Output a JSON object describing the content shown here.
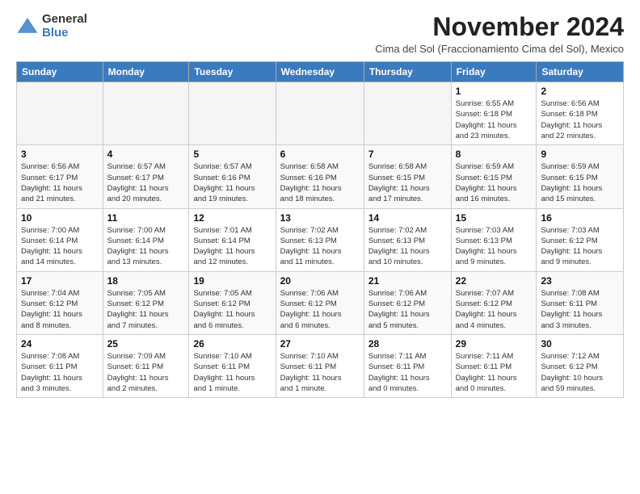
{
  "header": {
    "logo_general": "General",
    "logo_blue": "Blue",
    "month_title": "November 2024",
    "location": "Cima del Sol (Fraccionamiento Cima del Sol), Mexico"
  },
  "weekdays": [
    "Sunday",
    "Monday",
    "Tuesday",
    "Wednesday",
    "Thursday",
    "Friday",
    "Saturday"
  ],
  "weeks": [
    [
      {
        "day": "",
        "info": ""
      },
      {
        "day": "",
        "info": ""
      },
      {
        "day": "",
        "info": ""
      },
      {
        "day": "",
        "info": ""
      },
      {
        "day": "",
        "info": ""
      },
      {
        "day": "1",
        "info": "Sunrise: 6:55 AM\nSunset: 6:18 PM\nDaylight: 11 hours\nand 23 minutes."
      },
      {
        "day": "2",
        "info": "Sunrise: 6:56 AM\nSunset: 6:18 PM\nDaylight: 11 hours\nand 22 minutes."
      }
    ],
    [
      {
        "day": "3",
        "info": "Sunrise: 6:56 AM\nSunset: 6:17 PM\nDaylight: 11 hours\nand 21 minutes."
      },
      {
        "day": "4",
        "info": "Sunrise: 6:57 AM\nSunset: 6:17 PM\nDaylight: 11 hours\nand 20 minutes."
      },
      {
        "day": "5",
        "info": "Sunrise: 6:57 AM\nSunset: 6:16 PM\nDaylight: 11 hours\nand 19 minutes."
      },
      {
        "day": "6",
        "info": "Sunrise: 6:58 AM\nSunset: 6:16 PM\nDaylight: 11 hours\nand 18 minutes."
      },
      {
        "day": "7",
        "info": "Sunrise: 6:58 AM\nSunset: 6:15 PM\nDaylight: 11 hours\nand 17 minutes."
      },
      {
        "day": "8",
        "info": "Sunrise: 6:59 AM\nSunset: 6:15 PM\nDaylight: 11 hours\nand 16 minutes."
      },
      {
        "day": "9",
        "info": "Sunrise: 6:59 AM\nSunset: 6:15 PM\nDaylight: 11 hours\nand 15 minutes."
      }
    ],
    [
      {
        "day": "10",
        "info": "Sunrise: 7:00 AM\nSunset: 6:14 PM\nDaylight: 11 hours\nand 14 minutes."
      },
      {
        "day": "11",
        "info": "Sunrise: 7:00 AM\nSunset: 6:14 PM\nDaylight: 11 hours\nand 13 minutes."
      },
      {
        "day": "12",
        "info": "Sunrise: 7:01 AM\nSunset: 6:14 PM\nDaylight: 11 hours\nand 12 minutes."
      },
      {
        "day": "13",
        "info": "Sunrise: 7:02 AM\nSunset: 6:13 PM\nDaylight: 11 hours\nand 11 minutes."
      },
      {
        "day": "14",
        "info": "Sunrise: 7:02 AM\nSunset: 6:13 PM\nDaylight: 11 hours\nand 10 minutes."
      },
      {
        "day": "15",
        "info": "Sunrise: 7:03 AM\nSunset: 6:13 PM\nDaylight: 11 hours\nand 9 minutes."
      },
      {
        "day": "16",
        "info": "Sunrise: 7:03 AM\nSunset: 6:12 PM\nDaylight: 11 hours\nand 9 minutes."
      }
    ],
    [
      {
        "day": "17",
        "info": "Sunrise: 7:04 AM\nSunset: 6:12 PM\nDaylight: 11 hours\nand 8 minutes."
      },
      {
        "day": "18",
        "info": "Sunrise: 7:05 AM\nSunset: 6:12 PM\nDaylight: 11 hours\nand 7 minutes."
      },
      {
        "day": "19",
        "info": "Sunrise: 7:05 AM\nSunset: 6:12 PM\nDaylight: 11 hours\nand 6 minutes."
      },
      {
        "day": "20",
        "info": "Sunrise: 7:06 AM\nSunset: 6:12 PM\nDaylight: 11 hours\nand 6 minutes."
      },
      {
        "day": "21",
        "info": "Sunrise: 7:06 AM\nSunset: 6:12 PM\nDaylight: 11 hours\nand 5 minutes."
      },
      {
        "day": "22",
        "info": "Sunrise: 7:07 AM\nSunset: 6:12 PM\nDaylight: 11 hours\nand 4 minutes."
      },
      {
        "day": "23",
        "info": "Sunrise: 7:08 AM\nSunset: 6:11 PM\nDaylight: 11 hours\nand 3 minutes."
      }
    ],
    [
      {
        "day": "24",
        "info": "Sunrise: 7:08 AM\nSunset: 6:11 PM\nDaylight: 11 hours\nand 3 minutes."
      },
      {
        "day": "25",
        "info": "Sunrise: 7:09 AM\nSunset: 6:11 PM\nDaylight: 11 hours\nand 2 minutes."
      },
      {
        "day": "26",
        "info": "Sunrise: 7:10 AM\nSunset: 6:11 PM\nDaylight: 11 hours\nand 1 minute."
      },
      {
        "day": "27",
        "info": "Sunrise: 7:10 AM\nSunset: 6:11 PM\nDaylight: 11 hours\nand 1 minute."
      },
      {
        "day": "28",
        "info": "Sunrise: 7:11 AM\nSunset: 6:11 PM\nDaylight: 11 hours\nand 0 minutes."
      },
      {
        "day": "29",
        "info": "Sunrise: 7:11 AM\nSunset: 6:11 PM\nDaylight: 11 hours\nand 0 minutes."
      },
      {
        "day": "30",
        "info": "Sunrise: 7:12 AM\nSunset: 6:12 PM\nDaylight: 10 hours\nand 59 minutes."
      }
    ]
  ]
}
